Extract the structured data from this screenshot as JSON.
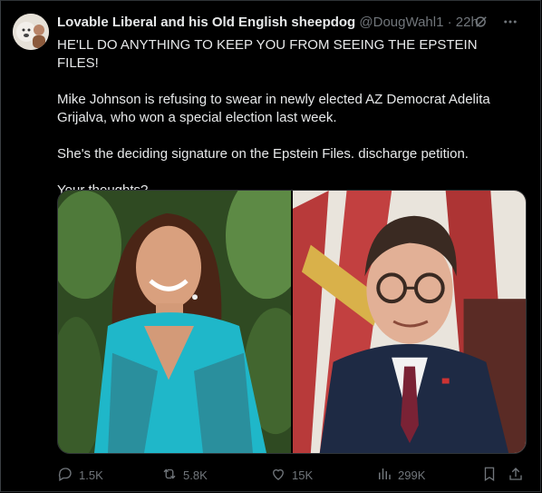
{
  "post": {
    "author_name": "Lovable Liberal and his Old English sheepdog",
    "handle": "@DougWahl1",
    "separator": "·",
    "time": "22h",
    "paragraphs": [
      "HE'LL DO ANYTHING TO KEEP YOU FROM SEEING THE EPSTEIN FILES!",
      "Mike Johnson is refusing to swear in newly elected AZ Democrat Adelita Grijalva, who won a special election last week.",
      "She's the deciding signature on the Epstein Files. discharge petition.",
      "Your thoughts?"
    ]
  },
  "actions": {
    "replies": "1.5K",
    "reposts": "5.8K",
    "likes": "15K",
    "views": "299K"
  },
  "icons": {
    "header": [
      "grok-icon",
      "more-icon"
    ],
    "actions": [
      "reply-icon",
      "repost-icon",
      "like-icon",
      "views-icon",
      "bookmark-icon",
      "share-icon"
    ]
  },
  "colors": {
    "background": "#000000",
    "text": "#e7e9ea",
    "muted": "#71767b",
    "border": "#2f3336"
  }
}
